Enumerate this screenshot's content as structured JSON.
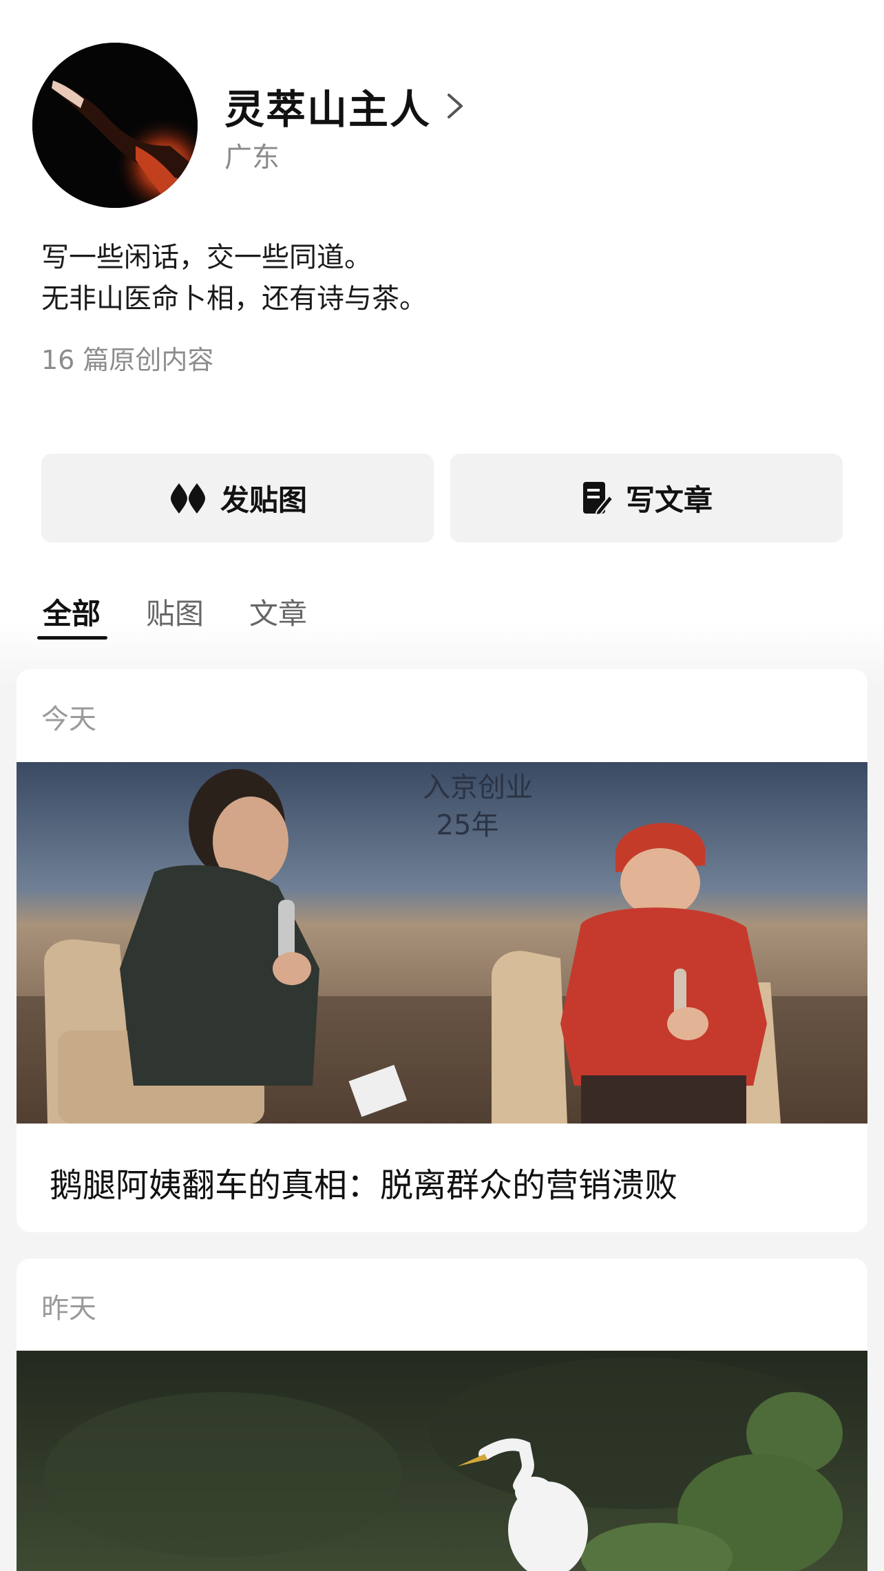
{
  "profile": {
    "name": "灵萃山主人",
    "region": "广东",
    "bio_line1": "写一些闲话，交一些同道。",
    "bio_line2": "无非山医命卜相，还有诗与茶。",
    "original_count": "16 篇原创内容"
  },
  "actions": {
    "post_image_label": "发贴图",
    "write_article_label": "写文章"
  },
  "tabs": [
    {
      "label": "全部",
      "active": true
    },
    {
      "label": "贴图",
      "active": false
    },
    {
      "label": "文章",
      "active": false
    }
  ],
  "feed": [
    {
      "date": "今天",
      "title": "鹅腿阿姨翻车的真相：脱离群众的营销溃败",
      "image_caption": "入京创业\n25年"
    },
    {
      "date": "昨天",
      "title": "",
      "image_caption": ""
    }
  ],
  "icons": {
    "chevron": "chevron-right-icon",
    "post_image": "diamond-pair-icon",
    "write_article": "document-pen-icon"
  },
  "colors": {
    "button_bg": "#f2f2f2",
    "muted_text": "#8a8a8a",
    "page_bg_lower": "#f4f4f4"
  }
}
